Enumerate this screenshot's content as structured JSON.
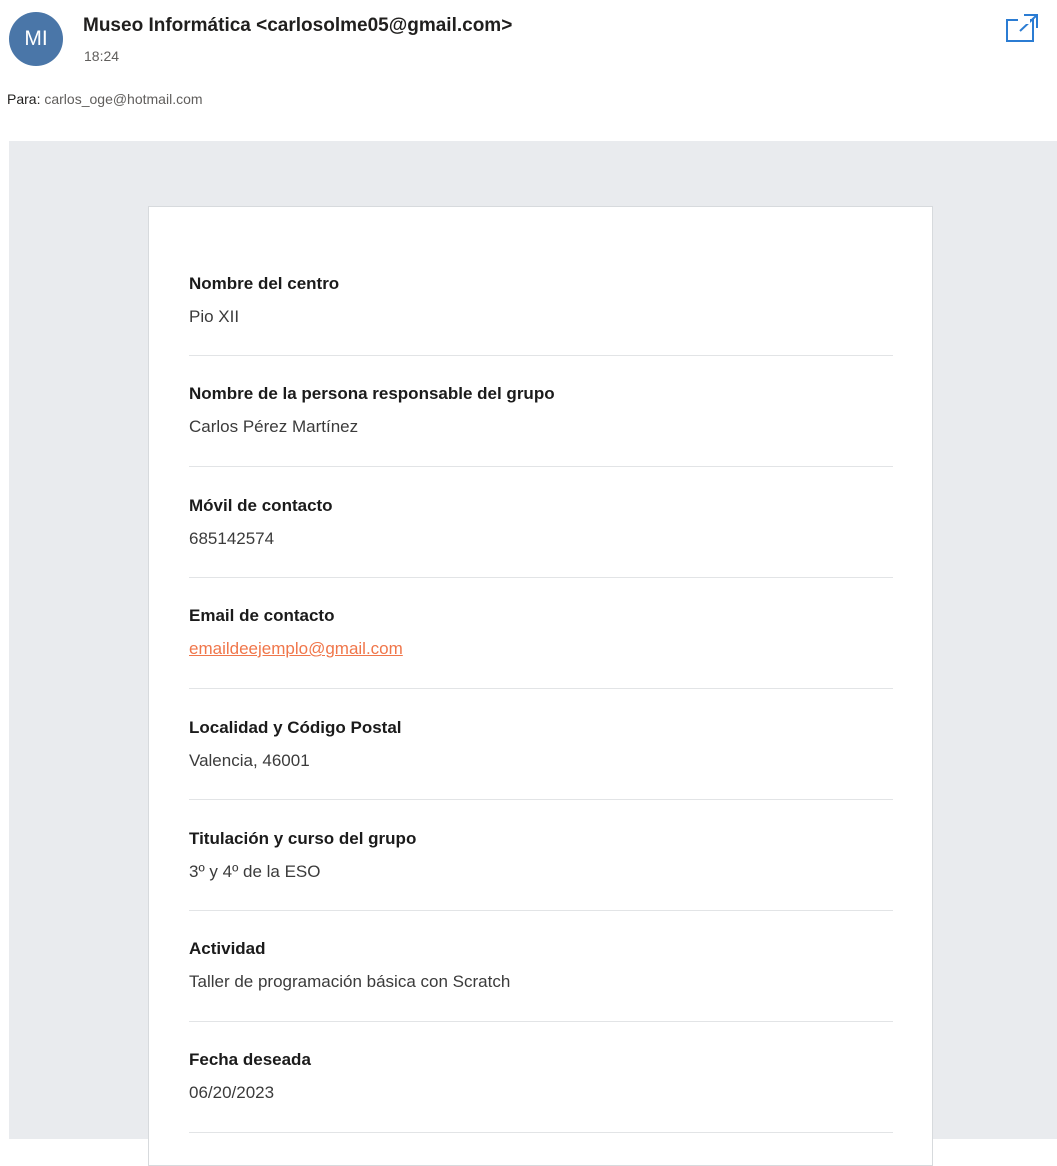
{
  "header": {
    "avatar_initials": "MI",
    "avatar_color": "#4a76a8",
    "sender": "Museo Informática <carlosolme05@gmail.com>",
    "time": "18:24",
    "to_label": "Para:",
    "to_value": "carlos_oge@hotmail.com",
    "popout_icon": "open-in-new-window-icon"
  },
  "fields": [
    {
      "label": "Nombre del centro",
      "value": "Pio XII"
    },
    {
      "label": "Nombre de la persona responsable del grupo",
      "value": "Carlos Pérez Martínez"
    },
    {
      "label": "Móvil de contacto",
      "value": "685142574"
    },
    {
      "label": "Email de contacto",
      "value": "emaildeejemplo@gmail.com"
    },
    {
      "label": "Localidad y Código Postal",
      "value": "Valencia, 46001"
    },
    {
      "label": "Titulación y curso del grupo",
      "value": "3º y 4º de la ESO"
    },
    {
      "label": "Actividad",
      "value": "Taller de programación básica con Scratch"
    },
    {
      "label": "Fecha deseada",
      "value": "06/20/2023"
    }
  ],
  "colors": {
    "link": "#f0764a",
    "body_background": "#e9ebee",
    "accent_icon": "#2b7cd3"
  }
}
